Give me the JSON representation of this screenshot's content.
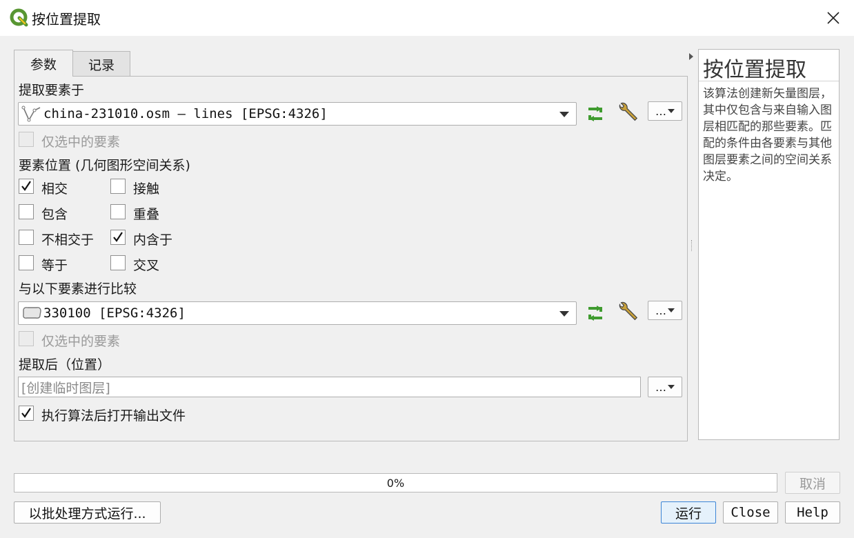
{
  "window": {
    "title": "按位置提取",
    "close_glyph": "✕"
  },
  "tabs": [
    {
      "label": "参数",
      "active": true
    },
    {
      "label": "记录",
      "active": false
    }
  ],
  "params": {
    "extract_from_label": "提取要素于",
    "input_layer": {
      "value": "china-231010.osm — lines [EPSG:4326]",
      "icon": "line-layer-icon"
    },
    "input_selected_only": {
      "label": "仅选中的要素",
      "checked": false,
      "enabled": false
    },
    "predicate_label": "要素位置 (几何图形空间关系)",
    "predicates": [
      {
        "label": "相交",
        "checked": true
      },
      {
        "label": "接触",
        "checked": false
      },
      {
        "label": "包含",
        "checked": false
      },
      {
        "label": "重叠",
        "checked": false
      },
      {
        "label": "不相交于",
        "checked": false
      },
      {
        "label": "内含于",
        "checked": true
      },
      {
        "label": "等于",
        "checked": false
      },
      {
        "label": "交叉",
        "checked": false
      }
    ],
    "compare_label": "与以下要素进行比较",
    "compare_layer": {
      "value": "330100 [EPSG:4326]",
      "icon": "polygon-layer-icon"
    },
    "compare_selected_only": {
      "label": "仅选中的要素",
      "checked": false,
      "enabled": false
    },
    "output_label": "提取后（位置）",
    "output_placeholder": "[创建临时图层]",
    "open_output": {
      "label": "执行算法后打开输出文件",
      "checked": true
    },
    "more_glyph": "…"
  },
  "help": {
    "title": "按位置提取",
    "text": "该算法创建新矢量图层，其中仅包含与来自输入图层相匹配的那些要素。匹配的条件由各要素与其他图层要素之间的空间关系决定。"
  },
  "footer": {
    "progress_value": 0,
    "progress_text": "0%",
    "cancel_label": "取消",
    "batch_label": "以批处理方式运行...",
    "run_label": "运行",
    "close_label": "Close",
    "help_label": "Help"
  },
  "colors": {
    "qgis_green": "#589632",
    "refresh_green": "#3f9b2f",
    "wrench_gold": "#c9a13a",
    "primary_border": "#3a84d6"
  }
}
